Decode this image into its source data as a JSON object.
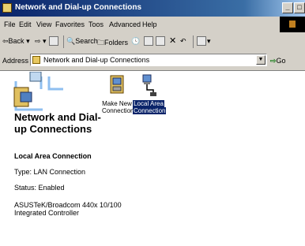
{
  "window": {
    "title": "Network and Dial-up Connections",
    "buttons": [
      "_",
      "□"
    ]
  },
  "menu": [
    "File",
    "Edit",
    "View",
    "Favorites",
    "Toos",
    "Advanced",
    "Help"
  ],
  "toolbar": {
    "back": "Back",
    "search": "Search",
    "folders": "Folders"
  },
  "address": {
    "label": "Address",
    "value": "Network and Dial-up Connections",
    "go": "Go"
  },
  "pane": {
    "title": "Network and Dial-up Connections",
    "section_title": "Local Area Connection",
    "type": "Type: LAN Connection",
    "status": "Status: Enabled",
    "device_line1": "ASUSTeK/Broadcom 440x 10/100",
    "device_line2": "Integrated Controller"
  },
  "icons": [
    {
      "label_line1": "Make New",
      "label_line2": "Connection",
      "icon": "make-new-connection-icon"
    },
    {
      "label_line1": "Local Area",
      "label_line2": "Connection",
      "icon": "local-area-connection-icon"
    }
  ]
}
